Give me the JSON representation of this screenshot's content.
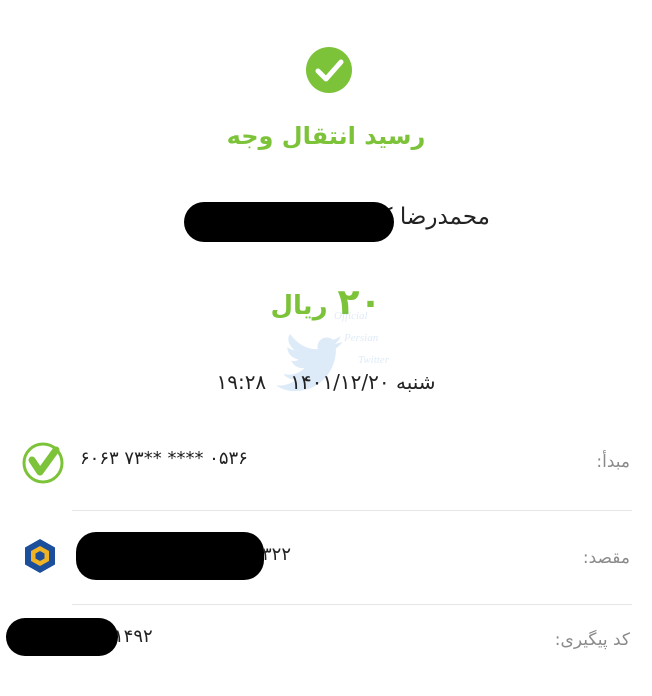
{
  "receipt": {
    "title": "رسید انتقال وجه",
    "recipient_name": "محمدرضا ک",
    "amount_value": "۲۰",
    "amount_unit": "ریال",
    "date": "شنبه ۱۴۰۱/۱۲/۲۰",
    "time": "۱۹:۲۸",
    "watermark_lines": [
      "Official",
      "Persian",
      "Twitter"
    ]
  },
  "details": {
    "source_label": "مبدأ:",
    "source_card": "۶۰۶۳ ۷۳** **** ۰۵۳۶",
    "destination_label": "مقصد:",
    "destination_card_suffix": "۳۲۲",
    "tracking_label": "کد پیگیری:",
    "tracking_code_suffix": "۱۴۹۲"
  },
  "colors": {
    "accent_green": "#7cc33a",
    "bank_blue": "#1b4f9c",
    "bank_gold": "#f0b323"
  }
}
